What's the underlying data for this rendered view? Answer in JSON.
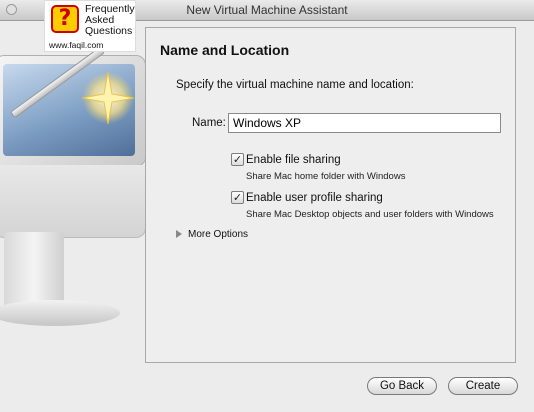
{
  "window": {
    "title": "New Virtual Machine Assistant"
  },
  "watermark": {
    "line1": "Frequently",
    "line2": "Asked",
    "line3": "Questions",
    "url": "www.faqil.com",
    "symbol": "?"
  },
  "page": {
    "heading": "Name and Location",
    "description": "Specify the virtual machine name and location:",
    "name_label": "Name:",
    "name_value": "Windows XP",
    "file_sharing": {
      "label": "Enable file sharing",
      "help": "Share Mac home folder with Windows",
      "checked": true
    },
    "profile_sharing": {
      "label": "Enable user profile sharing",
      "help": "Share Mac Desktop objects and user folders with Windows",
      "checked": true
    },
    "more_options": "More Options"
  },
  "buttons": {
    "back": "Go Back",
    "create": "Create"
  },
  "icons": {
    "check": "✓"
  }
}
